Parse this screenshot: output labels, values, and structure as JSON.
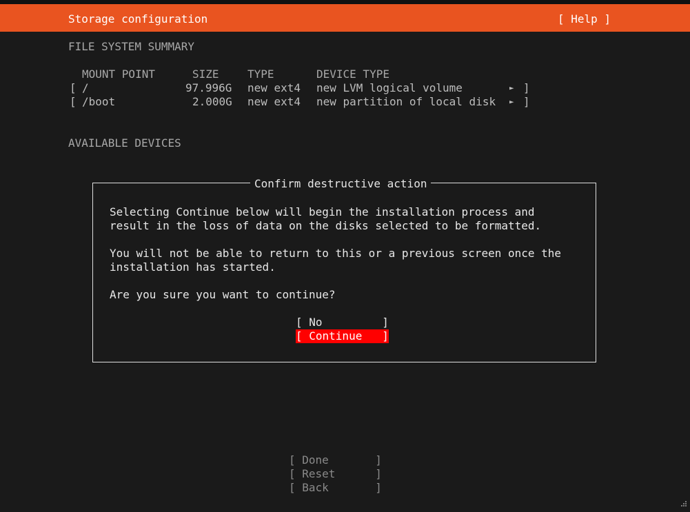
{
  "header": {
    "title": "Storage configuration",
    "help_label": "[ Help ]"
  },
  "summary": {
    "heading": "FILE SYSTEM SUMMARY",
    "columns": {
      "mount_point": "MOUNT POINT",
      "size": "SIZE",
      "type": "TYPE",
      "device_type": "DEVICE TYPE"
    },
    "rows": [
      {
        "open": "[",
        "mount": "/",
        "size": "97.996G",
        "type": "new ext4",
        "device_type": "new LVM logical volume",
        "arrow": "►",
        "close": "]"
      },
      {
        "open": "[",
        "mount": "/boot",
        "size": "2.000G",
        "type": "new ext4",
        "device_type": "new partition of local disk",
        "arrow": "►",
        "close": "]"
      }
    ]
  },
  "available_devices": {
    "heading": "AVAILABLE DEVICES"
  },
  "dialog": {
    "title": "Confirm destructive action",
    "paragraph1_line1": "Selecting Continue below will begin the installation process and",
    "paragraph1_line2": "result in the loss of data on the disks selected to be formatted.",
    "paragraph2_line1": "You will not be able to return to this or a previous screen once the",
    "paragraph2_line2": "installation has started.",
    "question": "Are you sure you want to continue?",
    "no_label": "[ No         ]",
    "continue_label": "[ Continue   ]"
  },
  "footer": {
    "done_label": "[ Done       ]",
    "reset_label": "[ Reset      ]",
    "back_label": "[ Back       ]"
  },
  "colors": {
    "header_bg": "#e95420",
    "focus_bg": "#ff0000",
    "screen_bg": "#1a1a1a"
  }
}
